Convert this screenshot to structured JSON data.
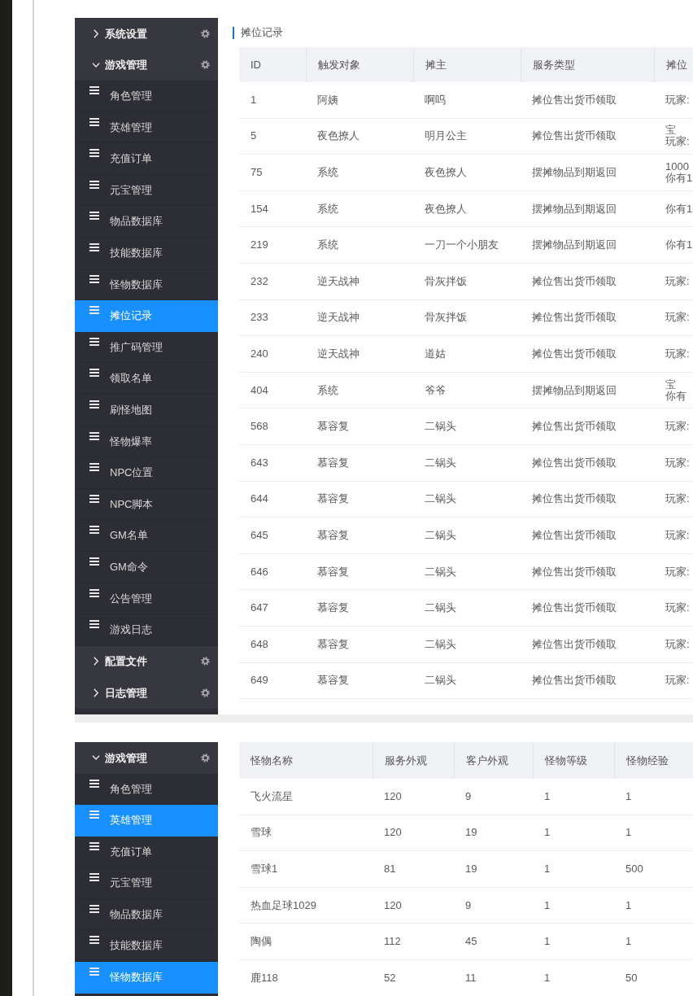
{
  "panels": [
    {
      "sidebar": {
        "groups": [
          {
            "label": "系统设置",
            "expanded": false
          },
          {
            "label": "游戏管理",
            "expanded": true,
            "items": [
              {
                "label": "角色管理",
                "selected": false
              },
              {
                "label": "英雄管理",
                "selected": false
              },
              {
                "label": "充值订单",
                "selected": false
              },
              {
                "label": "元宝管理",
                "selected": false
              },
              {
                "label": "物品数据库",
                "selected": false
              },
              {
                "label": "技能数据库",
                "selected": false
              },
              {
                "label": "怪物数据库",
                "selected": false
              },
              {
                "label": "摊位记录",
                "selected": true
              },
              {
                "label": "推广码管理",
                "selected": false
              },
              {
                "label": "领取名单",
                "selected": false
              },
              {
                "label": "刷怪地图",
                "selected": false
              },
              {
                "label": "怪物爆率",
                "selected": false
              },
              {
                "label": "NPC位置",
                "selected": false
              },
              {
                "label": "NPC脚本",
                "selected": false
              },
              {
                "label": "GM名单",
                "selected": false
              },
              {
                "label": "GM命令",
                "selected": false
              },
              {
                "label": "公告管理",
                "selected": false
              },
              {
                "label": "游戏日志",
                "selected": false
              }
            ]
          },
          {
            "label": "配置文件",
            "expanded": false
          },
          {
            "label": "日志管理",
            "expanded": false
          }
        ]
      },
      "title": "摊位记录",
      "table": {
        "columns": [
          "ID",
          "触发对象",
          "摊主",
          "服务类型",
          "摊位"
        ],
        "rows": [
          [
            "1",
            "阿姨",
            "啊呜",
            "摊位售出货币领取",
            "玩家:"
          ],
          [
            "5",
            "夜色撩人",
            "明月公主",
            "摊位售出货币领取",
            [
              "宝",
              "玩家:"
            ]
          ],
          [
            "75",
            "系统",
            "夜色撩人",
            "摆摊物品到期返回",
            [
              "1000",
              "你有1"
            ]
          ],
          [
            "154",
            "系统",
            "夜色撩人",
            "摆摊物品到期返回",
            "你有1"
          ],
          [
            "219",
            "系统",
            "一刀一个小朋友",
            "摆摊物品到期返回",
            "你有1"
          ],
          [
            "232",
            "逆天战神",
            "骨灰拌饭",
            "摊位售出货币领取",
            "玩家:"
          ],
          [
            "233",
            "逆天战神",
            "骨灰拌饭",
            "摊位售出货币领取",
            "玩家:"
          ],
          [
            "240",
            "逆天战神",
            "道姑",
            "摊位售出货币领取",
            "玩家:"
          ],
          [
            "404",
            "系统",
            "爷爷",
            "摆摊物品到期返回",
            [
              "宝",
              "你有"
            ]
          ],
          [
            "568",
            "慕容复",
            "二锅头",
            "摊位售出货币领取",
            "玩家:"
          ],
          [
            "643",
            "慕容复",
            "二锅头",
            "摊位售出货币领取",
            "玩家:"
          ],
          [
            "644",
            "慕容复",
            "二锅头",
            "摊位售出货币领取",
            "玩家:"
          ],
          [
            "645",
            "慕容复",
            "二锅头",
            "摊位售出货币领取",
            "玩家:"
          ],
          [
            "646",
            "慕容复",
            "二锅头",
            "摊位售出货币领取",
            "玩家:"
          ],
          [
            "647",
            "慕容复",
            "二锅头",
            "摊位售出货币领取",
            "玩家:"
          ],
          [
            "648",
            "慕容复",
            "二锅头",
            "摊位售出货币领取",
            "玩家:"
          ],
          [
            "649",
            "慕容复",
            "二锅头",
            "摊位售出货币领取",
            "玩家:"
          ]
        ]
      }
    },
    {
      "sidebar": {
        "groups": [
          {
            "label": "游戏管理",
            "expanded": true,
            "items": [
              {
                "label": "角色管理",
                "selected": false
              },
              {
                "label": "英雄管理",
                "selected": true
              },
              {
                "label": "充值订单",
                "selected": false
              },
              {
                "label": "元宝管理",
                "selected": false
              },
              {
                "label": "物品数据库",
                "selected": false
              },
              {
                "label": "技能数据库",
                "selected": false
              },
              {
                "label": "怪物数据库",
                "selected": true
              }
            ]
          }
        ]
      },
      "table": {
        "columns": [
          "怪物名称",
          "服务外观",
          "客户外观",
          "怪物等级",
          "怪物经验"
        ],
        "rows": [
          [
            "飞火流星",
            "120",
            "9",
            "1",
            "1"
          ],
          [
            "雪球",
            "120",
            "19",
            "1",
            "1"
          ],
          [
            "雪球1",
            "81",
            "19",
            "1",
            "500"
          ],
          [
            "热血足球1029",
            "120",
            "9",
            "1",
            "1"
          ],
          [
            "陶偶",
            "112",
            "45",
            "1",
            "1"
          ],
          [
            "鹿118",
            "52",
            "11",
            "1",
            "50"
          ]
        ]
      }
    }
  ]
}
